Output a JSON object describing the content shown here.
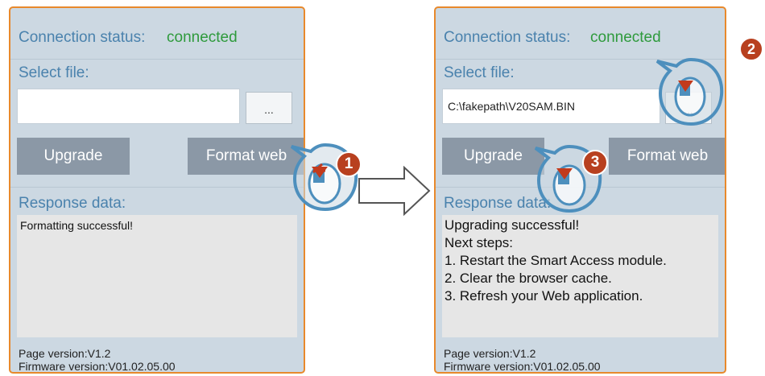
{
  "left_panel": {
    "connection_label": "Connection status:",
    "connection_value": "connected",
    "select_file_label": "Select file:",
    "file_value": "",
    "browse_label": "...",
    "upgrade_label": "Upgrade",
    "format_label": "Format web",
    "response_label": "Response data:",
    "response_lines": [
      "Formatting successful!"
    ],
    "page_version": "Page version:V1.2",
    "firmware_version": "Firmware version:V01.02.05.00"
  },
  "right_panel": {
    "connection_label": "Connection status:",
    "connection_value": "connected",
    "select_file_label": "Select file:",
    "file_value": "C:\\fakepath\\V20SAM.BIN",
    "browse_label": "...",
    "upgrade_label": "Upgrade",
    "format_label": "Format web",
    "response_label": "Response data:",
    "response_lines": [
      "Upgrading successful!",
      "Next steps:",
      "1. Restart the Smart Access module.",
      "2. Clear the browser cache.",
      "3. Refresh your Web application."
    ],
    "page_version": "Page version:V1.2",
    "firmware_version": "Firmware version:V01.02.05.00"
  },
  "callouts": [
    "1",
    "2",
    "3"
  ],
  "icons": [
    "mouse-click-icon",
    "right-arrow-icon"
  ],
  "colors": {
    "panel_border": "#e8892c",
    "panel_bg": "#ccd8e2",
    "label_blue": "#4a82ad",
    "connected_green": "#2e9a3c",
    "button_gray": "#8b98a6",
    "callout_red": "#b8401f"
  }
}
